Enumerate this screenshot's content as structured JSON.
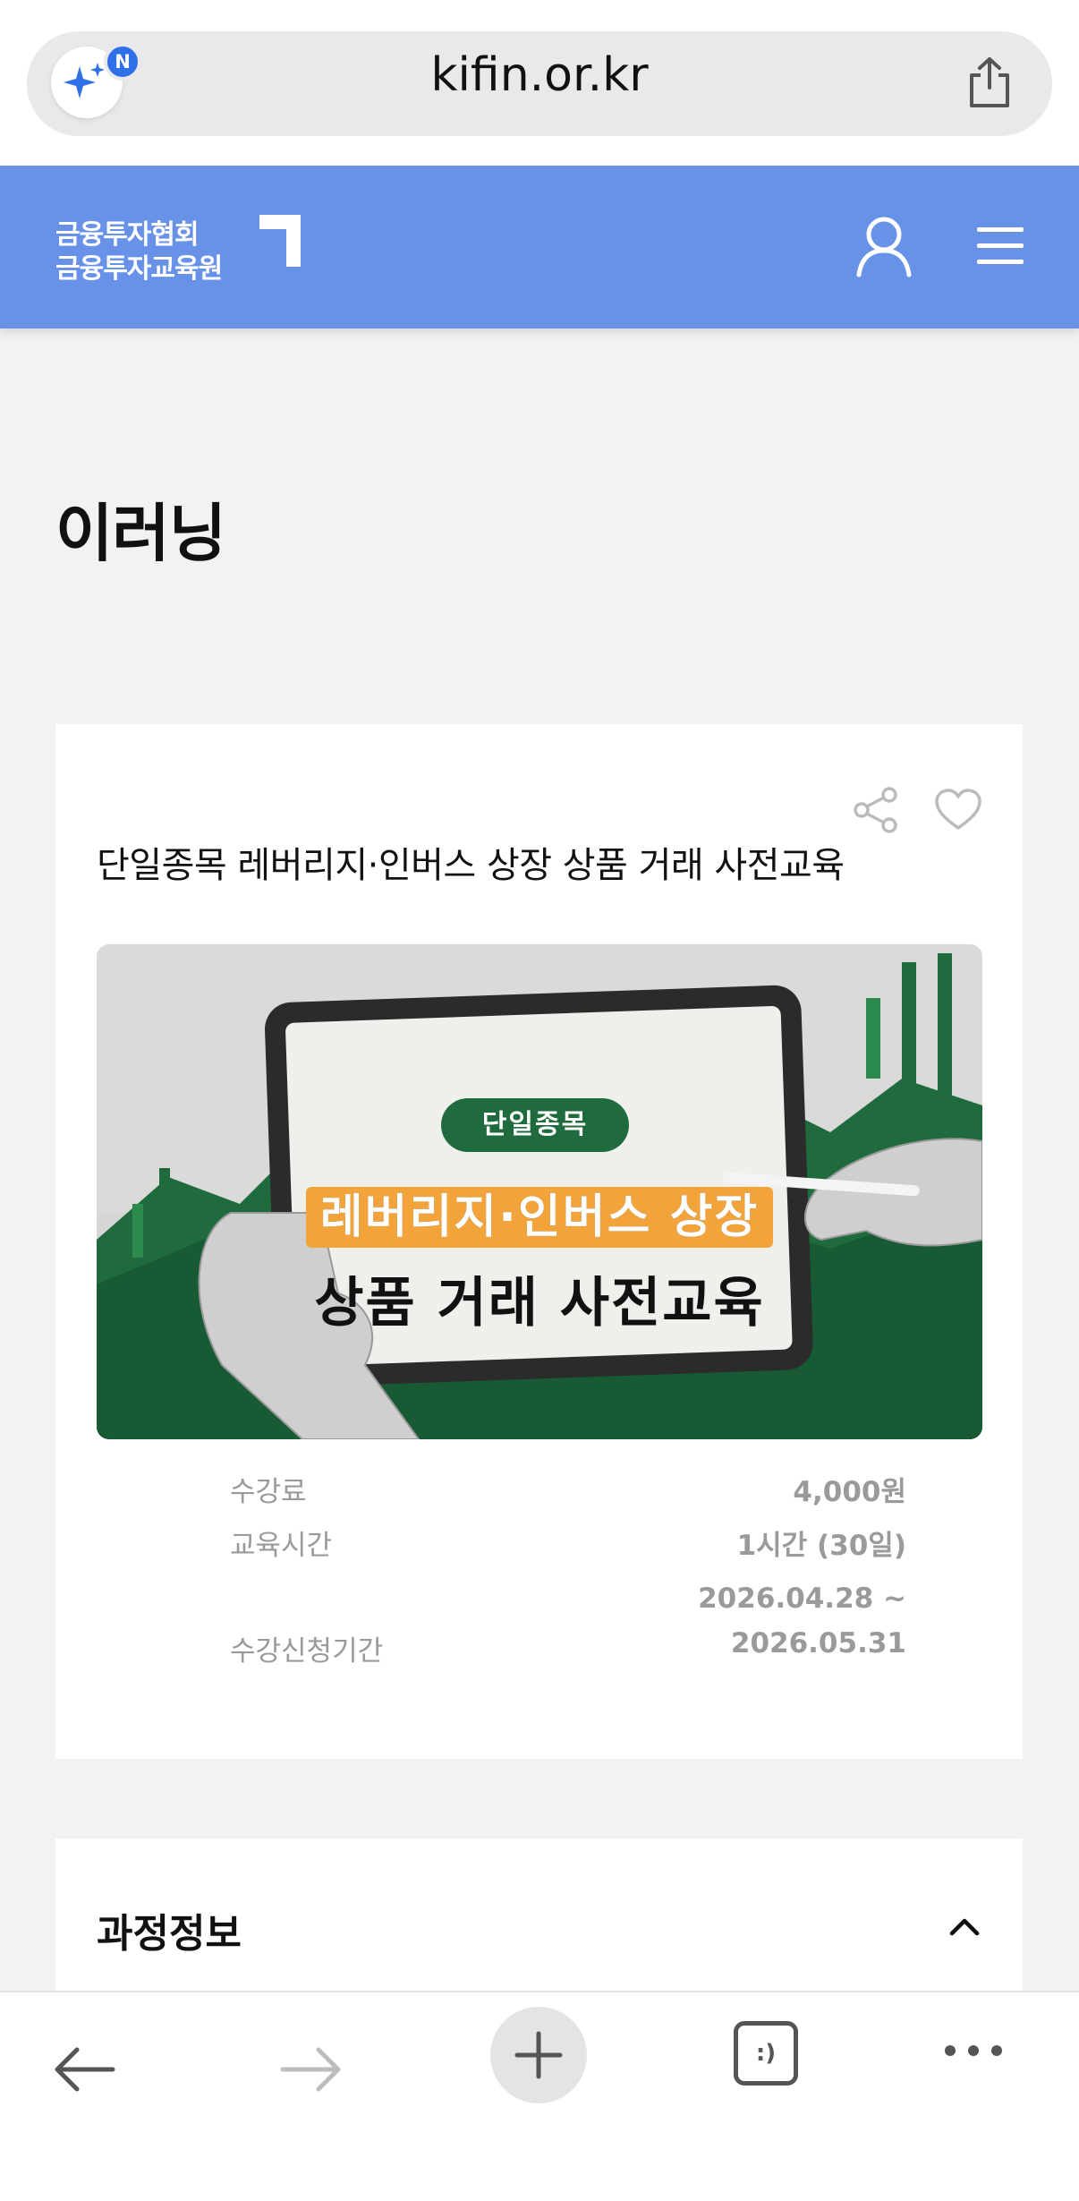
{
  "browser": {
    "url": "kifin.or.kr",
    "badge": "N"
  },
  "header": {
    "logo_line1": "금융투자협회",
    "logo_line2": "금융투자교육원"
  },
  "page": {
    "title": "이러닝"
  },
  "course": {
    "title": "단일종목 레버리지·인버스 상장 상품 거래 사전교육",
    "thumbnail": {
      "tag": "단일종목",
      "line1": "레버리지·인버스 상장",
      "line2": "상품 거래 사전교육"
    },
    "info": [
      {
        "label": "수강료",
        "value": "4,000원"
      },
      {
        "label": "교육시간",
        "value": "1시간 (30일)"
      },
      {
        "label": "수강신청기간",
        "value_line1": "2026.04.28 ~",
        "value_line2": "2026.05.31"
      }
    ]
  },
  "accordion": {
    "title": "과정정보"
  },
  "toolbar": {
    "tabs_label": ":)"
  },
  "colors": {
    "header_bg": "#6892e8",
    "page_bg": "#f2f2f2",
    "card_bg": "#ffffff",
    "thumb_green": "#1f6b3d",
    "thumb_orange": "#f2a43a",
    "meta_text": "#9a9a9a"
  },
  "icons": [
    "ai-sparkle-icon",
    "share-icon",
    "user-icon",
    "menu-icon",
    "heart-icon",
    "chevron-up-icon",
    "back-arrow-icon",
    "forward-arrow-icon",
    "plus-icon",
    "more-icon"
  ]
}
